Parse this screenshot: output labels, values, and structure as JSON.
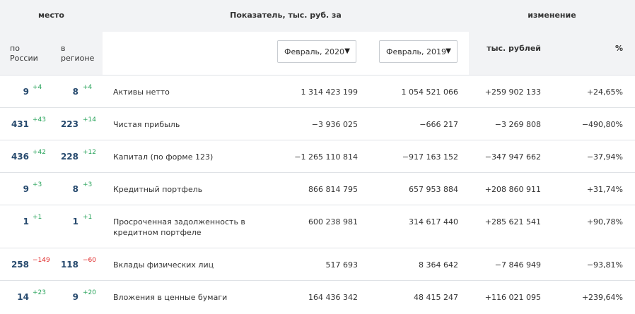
{
  "header": {
    "place": "место",
    "indicator": "Показатель, тыс. руб. за",
    "change": "изменение",
    "region_russia": "по\nРоссии",
    "region_local": "в\nрегионе",
    "select1": "Февраль, 2020",
    "select2": "Февраль, 2019",
    "rub": "тыс. рублей",
    "pct": "%"
  },
  "rows": [
    {
      "r1": "9",
      "d1": "+4",
      "r2": "8",
      "d2": "+4",
      "name": "Активы нетто",
      "v1": "1 314 423 199",
      "v2": "1 054 521 066",
      "ch": "+259 902 133",
      "pct": "+24,65%"
    },
    {
      "r1": "431",
      "d1": "+43",
      "r2": "223",
      "d2": "+14",
      "name": "Чистая прибыль",
      "v1": "−3 936 025",
      "v2": "−666 217",
      "ch": "−3 269 808",
      "pct": "−490,80%"
    },
    {
      "r1": "436",
      "d1": "+42",
      "r2": "228",
      "d2": "+12",
      "name": "Капитал (по форме 123)",
      "v1": "−1 265 110 814",
      "v2": "−917 163 152",
      "ch": "−347 947 662",
      "pct": "−37,94%"
    },
    {
      "r1": "9",
      "d1": "+3",
      "r2": "8",
      "d2": "+3",
      "name": "Кредитный портфель",
      "v1": "866 814 795",
      "v2": "657 953 884",
      "ch": "+208 860 911",
      "pct": "+31,74%"
    },
    {
      "r1": "1",
      "d1": "+1",
      "r2": "1",
      "d2": "+1",
      "name": "Просроченная задолженность в кредитном портфеле",
      "v1": "600 238 981",
      "v2": "314 617 440",
      "ch": "+285 621 541",
      "pct": "+90,78%"
    },
    {
      "r1": "258",
      "d1": "−149",
      "r2": "118",
      "d2": "−60",
      "name": "Вклады физических лиц",
      "v1": "517 693",
      "v2": "8 364 642",
      "ch": "−7 846 949",
      "pct": "−93,81%"
    },
    {
      "r1": "14",
      "d1": "+23",
      "r2": "9",
      "d2": "+20",
      "name": "Вложения в ценные бумаги",
      "v1": "164 436 342",
      "v2": "48 415 247",
      "ch": "+116 021 095",
      "pct": "+239,64%"
    }
  ]
}
